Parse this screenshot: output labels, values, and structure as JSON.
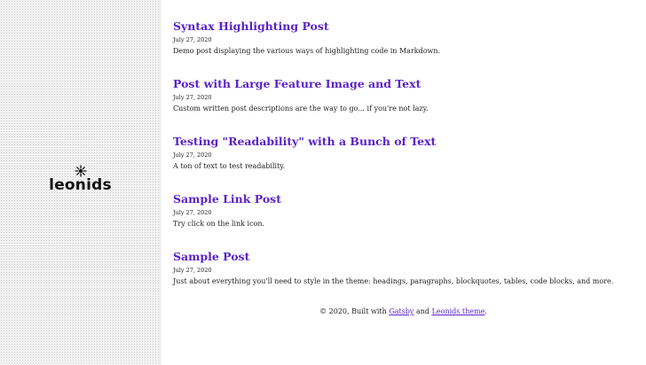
{
  "sidebar": {
    "brand": "leonids",
    "logo_icon": "sun-burst-icon"
  },
  "posts": [
    {
      "title": "Syntax Highlighting Post",
      "date": "July 27, 2020",
      "description": "Demo post displaying the various ways of highlighting code in Markdown."
    },
    {
      "title": "Post with Large Feature Image and Text",
      "date": "July 27, 2020",
      "description": "Custom written post descriptions are the way to go... if you're not lazy."
    },
    {
      "title": "Testing \"Readability\" with a Bunch of Text",
      "date": "July 27, 2020",
      "description": "A ton of text to test readability."
    },
    {
      "title": "Sample Link Post",
      "date": "July 27, 2020",
      "description": "Try click on the link icon."
    },
    {
      "title": "Sample Post",
      "date": "July 27, 2020",
      "description": "Just about everything you'll need to style in the theme: headings, paragraphs, blockquotes, tables, code blocks, and more."
    }
  ],
  "footer": {
    "prefix": "© 2020, Built with",
    "link1": "Gatsby",
    "joiner": "and",
    "link2": "Leonids theme",
    "suffix": "."
  },
  "colors": {
    "link": "#5a22c9",
    "text": "#222222"
  }
}
